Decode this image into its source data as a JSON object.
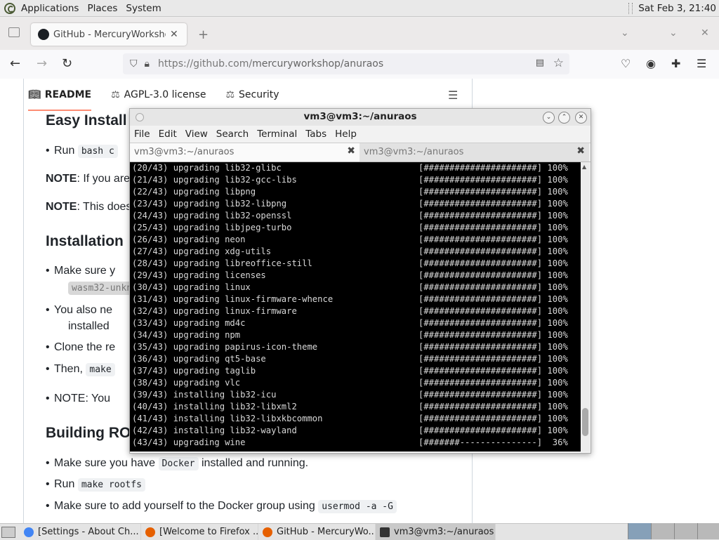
{
  "panel": {
    "menus": [
      "Applications",
      "Places",
      "System"
    ],
    "clock": "Sat Feb  3, 21:40"
  },
  "browser": {
    "tab_title": "GitHub - MercuryWorkshop/anuraos",
    "url_host": "https://github.com/",
    "url_path": "mercuryworkshop/anuraos"
  },
  "readme": {
    "tabs": [
      {
        "icon": "book-icon",
        "label": "README"
      },
      {
        "icon": "scale-icon",
        "label": "AGPL-3.0 license"
      },
      {
        "icon": "scale-icon",
        "label": "Security"
      }
    ],
    "h_easy": "Easy Install (",
    "run_label": "Run",
    "run_code": "bash c",
    "note1_bold": "NOTE",
    "note1_rest": ": If you are",
    "note2_bold": "NOTE",
    "note2_rest": ": This does",
    "h_install": "Installation",
    "make_sure": "Make sure y",
    "wasm_code": "wasm32-unkn",
    "you_also": "You also ne",
    "installed": "installed",
    "clone": "Clone the re",
    "then_label": "Then,",
    "then_code": "make",
    "note3": "NOTE: You",
    "h_building": "Building RO",
    "docker_pre": "Make sure you have",
    "docker_code": "Docker",
    "docker_post": "installed and running.",
    "run2_label": "Run",
    "run2_code": "make rootfs",
    "group_pre": "Make sure to add yourself to the Docker group using",
    "group_code": "usermod -a -G"
  },
  "terminal": {
    "title": "vm3@vm3:~/anuraos",
    "menus": [
      "File",
      "Edit",
      "View",
      "Search",
      "Terminal",
      "Tabs",
      "Help"
    ],
    "tabs": [
      "vm3@vm3:~/anuraos",
      "vm3@vm3:~/anuraos"
    ],
    "lines": [
      {
        "text": "(20/43) upgrading lib32-glibc",
        "prog": "[######################] 100%"
      },
      {
        "text": "(21/43) upgrading lib32-gcc-libs",
        "prog": "[######################] 100%"
      },
      {
        "text": "(22/43) upgrading libpng",
        "prog": "[######################] 100%"
      },
      {
        "text": "(23/43) upgrading lib32-libpng",
        "prog": "[######################] 100%"
      },
      {
        "text": "(24/43) upgrading lib32-openssl",
        "prog": "[######################] 100%"
      },
      {
        "text": "(25/43) upgrading libjpeg-turbo",
        "prog": "[######################] 100%"
      },
      {
        "text": "(26/43) upgrading neon",
        "prog": "[######################] 100%"
      },
      {
        "text": "(27/43) upgrading xdg-utils",
        "prog": "[######################] 100%"
      },
      {
        "text": "(28/43) upgrading libreoffice-still",
        "prog": "[######################] 100%"
      },
      {
        "text": "(29/43) upgrading licenses",
        "prog": "[######################] 100%"
      },
      {
        "text": "(30/43) upgrading linux",
        "prog": "[######################] 100%"
      },
      {
        "text": "(31/43) upgrading linux-firmware-whence",
        "prog": "[######################] 100%"
      },
      {
        "text": "(32/43) upgrading linux-firmware",
        "prog": "[######################] 100%"
      },
      {
        "text": "(33/43) upgrading md4c",
        "prog": "[######################] 100%"
      },
      {
        "text": "(34/43) upgrading npm",
        "prog": "[######################] 100%"
      },
      {
        "text": "(35/43) upgrading papirus-icon-theme",
        "prog": "[######################] 100%"
      },
      {
        "text": "(36/43) upgrading qt5-base",
        "prog": "[######################] 100%"
      },
      {
        "text": "(37/43) upgrading taglib",
        "prog": "[######################] 100%"
      },
      {
        "text": "(38/43) upgrading vlc",
        "prog": "[######################] 100%"
      },
      {
        "text": "(39/43) installing lib32-icu",
        "prog": "[######################] 100%"
      },
      {
        "text": "(40/43) installing lib32-libxml2",
        "prog": "[######################] 100%"
      },
      {
        "text": "(41/43) installing lib32-libxkbcommon",
        "prog": "[######################] 100%"
      },
      {
        "text": "(42/43) installing lib32-wayland",
        "prog": "[######################] 100%"
      },
      {
        "text": "(43/43) upgrading wine",
        "prog": "[#######---------------]  36%"
      }
    ]
  },
  "taskbar": {
    "items": [
      {
        "icon": "chrome-icon",
        "label": "[Settings - About Ch...",
        "color": "#4285f4"
      },
      {
        "icon": "firefox-icon",
        "label": "[Welcome to Firefox ...",
        "color": "#e66000"
      },
      {
        "icon": "firefox-icon",
        "label": "GitHub - MercuryWo...",
        "color": "#e66000"
      },
      {
        "icon": "terminal-icon",
        "label": "vm3@vm3:~/anuraos",
        "color": "#333333"
      }
    ]
  }
}
